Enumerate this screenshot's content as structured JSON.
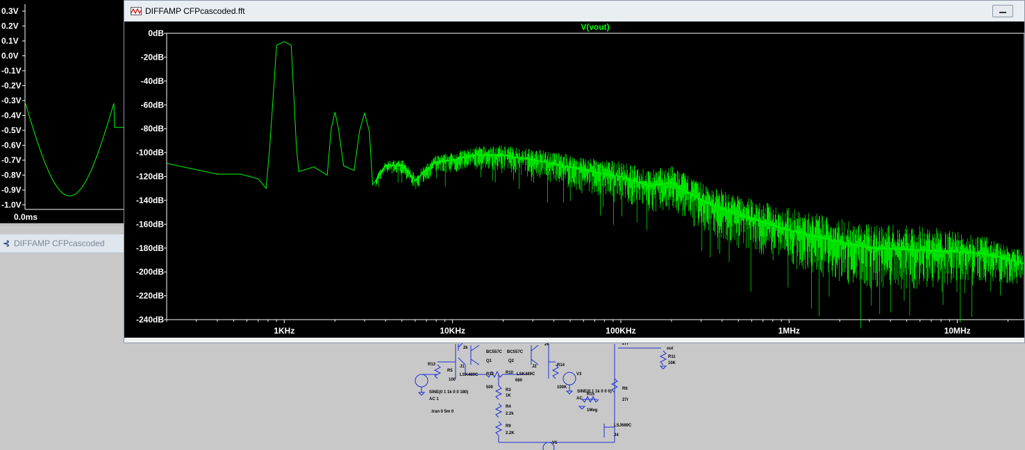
{
  "transient": {
    "y_labels": [
      "0.3V",
      "0.2V",
      "0.1V",
      "0.0V",
      "-0.1V",
      "-0.2V",
      "-0.3V",
      "-0.4V",
      "-0.5V",
      "-0.6V",
      "-0.7V",
      "-0.8V",
      "-0.9V",
      "-1.0V"
    ],
    "x_labels": [
      "0.0ms"
    ],
    "trace_color": "#00ff00"
  },
  "schematic": {
    "title": "DIFFAMP CFPcascoded",
    "icon": "schematic-icon",
    "components": [
      "R13",
      "R5",
      "100",
      "SINE(0 1 1k 0 0 180)",
      "AC 1",
      "J1",
      "LSK489C",
      "Q1",
      "BC557C",
      "BC557C",
      "Q2",
      "J2",
      "R14",
      "R12",
      "500",
      "R10",
      "LSK489C",
      "680",
      "R3",
      "1K",
      "R4",
      "2.2k",
      "R9",
      "2.2K",
      "100K",
      "V3",
      "SINE(0 1 1k 0 0 0)",
      "AC",
      "R15",
      "1Meg",
      "R6",
      "27r",
      "LSJ689C",
      "J4",
      "R11",
      "10K",
      "out",
      "V1",
      ".tran 0 5m 0",
      "2k",
      "2k",
      "27r"
    ]
  },
  "fft_window": {
    "title": "DIFFAMP CFPcascoded.fft",
    "icon": "waveform-icon",
    "minimize_icon": "minimize-icon"
  },
  "chart_data": {
    "type": "line",
    "title": "",
    "trace_name": "V(vout)",
    "xlabel": "",
    "ylabel": "",
    "x_scale": "log",
    "xlim": [
      200,
      25000000
    ],
    "ylim": [
      -240,
      0
    ],
    "x_ticks": [
      "1KHz",
      "10KHz",
      "100KHz",
      "1MHz",
      "10MHz"
    ],
    "y_ticks": [
      "0dB",
      "-20dB",
      "-40dB",
      "-60dB",
      "-80dB",
      "-100dB",
      "-120dB",
      "-140dB",
      "-160dB",
      "-180dB",
      "-200dB",
      "-220dB",
      "-240dB"
    ],
    "grid": false,
    "series": [
      {
        "color": "#00ff00",
        "points": [
          [
            200,
            -109
          ],
          [
            400,
            -118
          ],
          [
            550,
            -118
          ],
          [
            700,
            -122
          ],
          [
            780,
            -130
          ],
          [
            820,
            -95
          ],
          [
            900,
            -10
          ],
          [
            1000,
            -7
          ],
          [
            1100,
            -10
          ],
          [
            1180,
            -95
          ],
          [
            1220,
            -116
          ],
          [
            1500,
            -112
          ],
          [
            1800,
            -119
          ],
          [
            1900,
            -80
          ],
          [
            2000,
            -66
          ],
          [
            2100,
            -80
          ],
          [
            2250,
            -111
          ],
          [
            2600,
            -115
          ],
          [
            2800,
            -82
          ],
          [
            3000,
            -67
          ],
          [
            3200,
            -82
          ],
          [
            3350,
            -127
          ],
          [
            4000,
            -111
          ],
          [
            5000,
            -110
          ],
          [
            6000,
            -123
          ],
          [
            8000,
            -108
          ],
          [
            10000,
            -106
          ],
          [
            14000,
            -102
          ],
          [
            20000,
            -102
          ],
          [
            30000,
            -106
          ],
          [
            50000,
            -112
          ],
          [
            80000,
            -118
          ],
          [
            100000,
            -120
          ],
          [
            150000,
            -128
          ],
          [
            200000,
            -125
          ],
          [
            300000,
            -140
          ],
          [
            500000,
            -152
          ],
          [
            1000000,
            -165
          ],
          [
            2000000,
            -175
          ],
          [
            3000000,
            -180
          ],
          [
            5000000,
            -181
          ],
          [
            10000000,
            -183
          ],
          [
            15000000,
            -185
          ],
          [
            25000000,
            -193
          ]
        ]
      }
    ]
  }
}
